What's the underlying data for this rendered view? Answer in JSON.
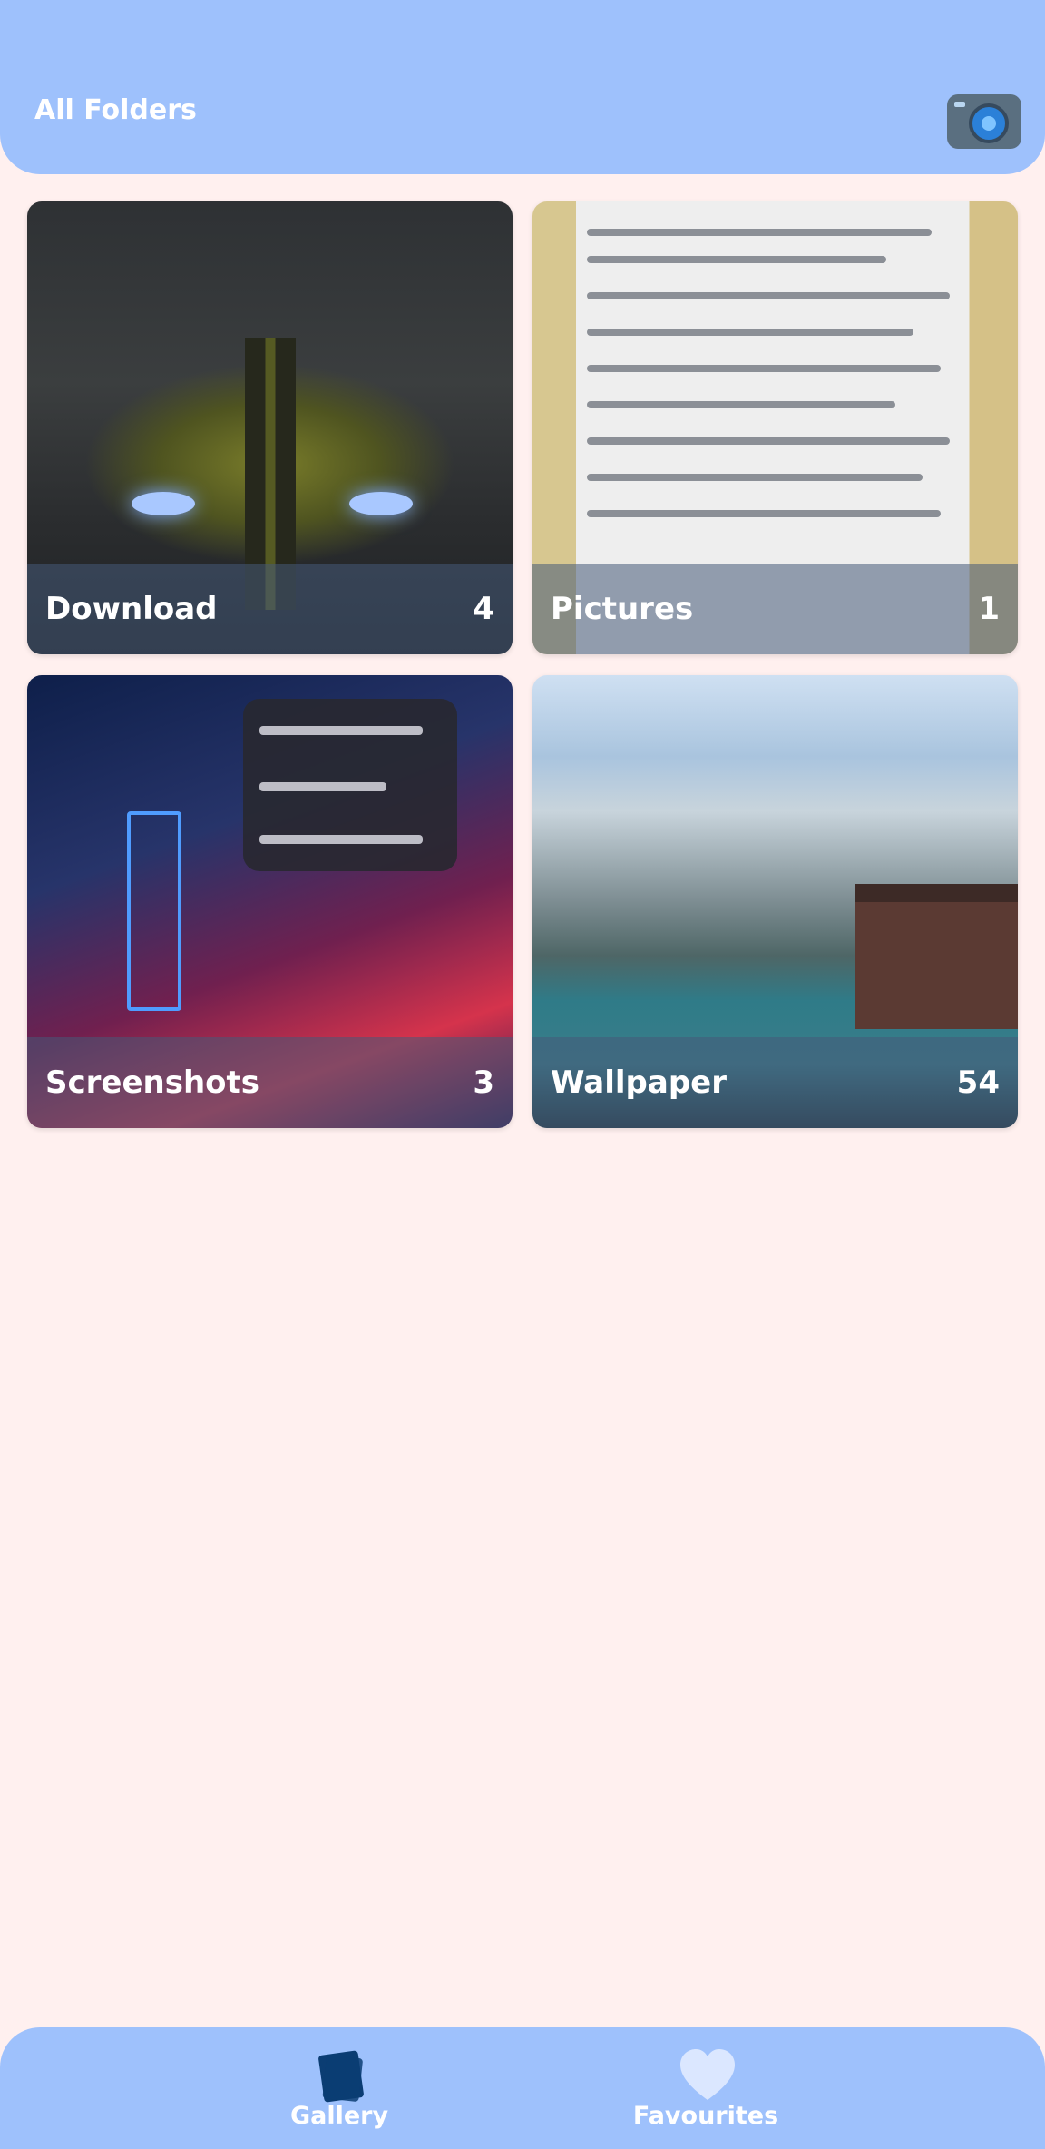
{
  "header": {
    "title": "All Folders",
    "camera_icon": "camera-icon"
  },
  "folders": [
    {
      "name": "Download",
      "count": "4"
    },
    {
      "name": "Pictures",
      "count": "1"
    },
    {
      "name": "Screenshots",
      "count": "3"
    },
    {
      "name": "Wallpaper",
      "count": "54"
    }
  ],
  "bottom_nav": {
    "items": [
      {
        "label": "Gallery",
        "icon": "gallery-icon",
        "active": true
      },
      {
        "label": "Favourites",
        "icon": "heart-icon",
        "active": false
      }
    ]
  },
  "colors": {
    "app_bar": "#9ec1fc",
    "background": "#fff0ef",
    "nav_active": "#0b3d73",
    "nav_inactive": "#dbe7ff"
  }
}
